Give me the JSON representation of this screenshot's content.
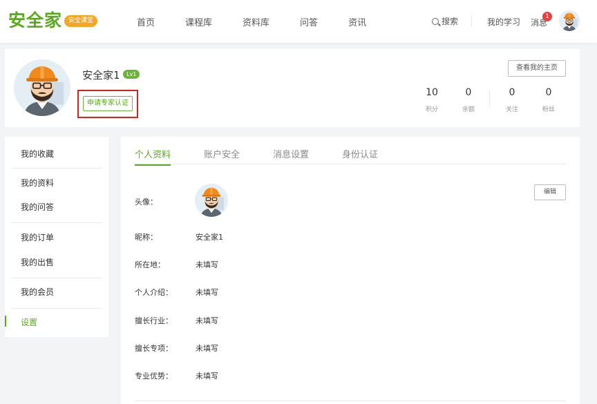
{
  "header": {
    "logo_text": "安全家",
    "logo_badge": "安全课堂",
    "nav": [
      "首页",
      "课程库",
      "资料库",
      "问答",
      "资讯"
    ],
    "search_label": "搜索",
    "my_study": "我的学习",
    "messages": "消息",
    "message_count": "1"
  },
  "profile": {
    "username": "安全家1",
    "level": "Lv1",
    "apply_expert": "申请专家认证",
    "view_homepage": "查看我的主页",
    "stats": [
      {
        "value": "10",
        "label": "积分"
      },
      {
        "value": "0",
        "label": "余额"
      },
      {
        "value": "0",
        "label": "关注"
      },
      {
        "value": "0",
        "label": "粉丝"
      }
    ]
  },
  "sidebar": {
    "items": [
      "我的收藏",
      "我的资料",
      "我的问答",
      "我的订单",
      "我的出售",
      "我的会员",
      "设置"
    ],
    "active": "设置"
  },
  "main": {
    "tabs": [
      "个人资料",
      "账户安全",
      "消息设置",
      "身份认证"
    ],
    "active_tab": "个人资料",
    "edit_label": "编辑",
    "fields": [
      {
        "label": "头像：",
        "value": ""
      },
      {
        "label": "昵称：",
        "value": "安全家1"
      },
      {
        "label": "所在地：",
        "value": "未填写"
      },
      {
        "label": "个人介绍：",
        "value": "未填写"
      },
      {
        "label": "擅长行业：",
        "value": "未填写"
      },
      {
        "label": "擅长专项：",
        "value": "未填写"
      },
      {
        "label": "专业优势：",
        "value": "未填写"
      }
    ]
  },
  "colors": {
    "brand_green": "#5aa820",
    "logo_badge_orange": "#f5a623",
    "highlight_red": "#d9221c",
    "badge_red": "#e64340"
  }
}
